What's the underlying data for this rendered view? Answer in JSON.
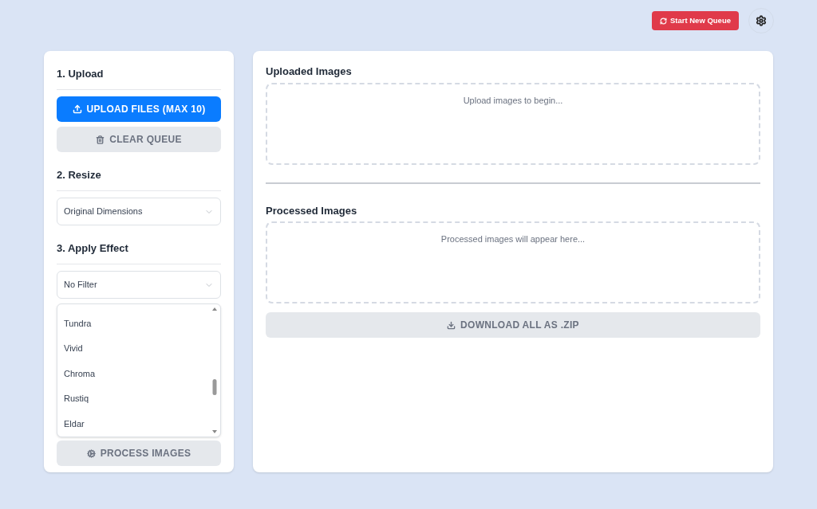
{
  "header": {
    "new_queue_button": "Start New Queue"
  },
  "sidebar": {
    "upload": {
      "title": "1. Upload",
      "upload_button": {
        "label": "UPLOAD FILES (MAX 10)",
        "disabled": false
      },
      "clear_button": {
        "label": "CLEAR QUEUE",
        "disabled": true
      }
    },
    "resize": {
      "title": "2. Resize",
      "value": "Original Dimensions"
    },
    "effect": {
      "title": "3. Apply Effect",
      "value": "No Filter",
      "open": true,
      "options": [
        "Tundra",
        "Vivid",
        "Chroma",
        "Rustiq",
        "Eldar"
      ]
    },
    "process_button": {
      "label": "PROCESS IMAGES",
      "disabled": true
    }
  },
  "main": {
    "uploaded": {
      "title": "Uploaded Images",
      "empty_text": "Upload images to begin..."
    },
    "processed": {
      "title": "Processed Images",
      "empty_text": "Processed images will appear here..."
    },
    "download_button": {
      "label": "DOWNLOAD ALL AS .ZIP",
      "disabled": true
    }
  }
}
